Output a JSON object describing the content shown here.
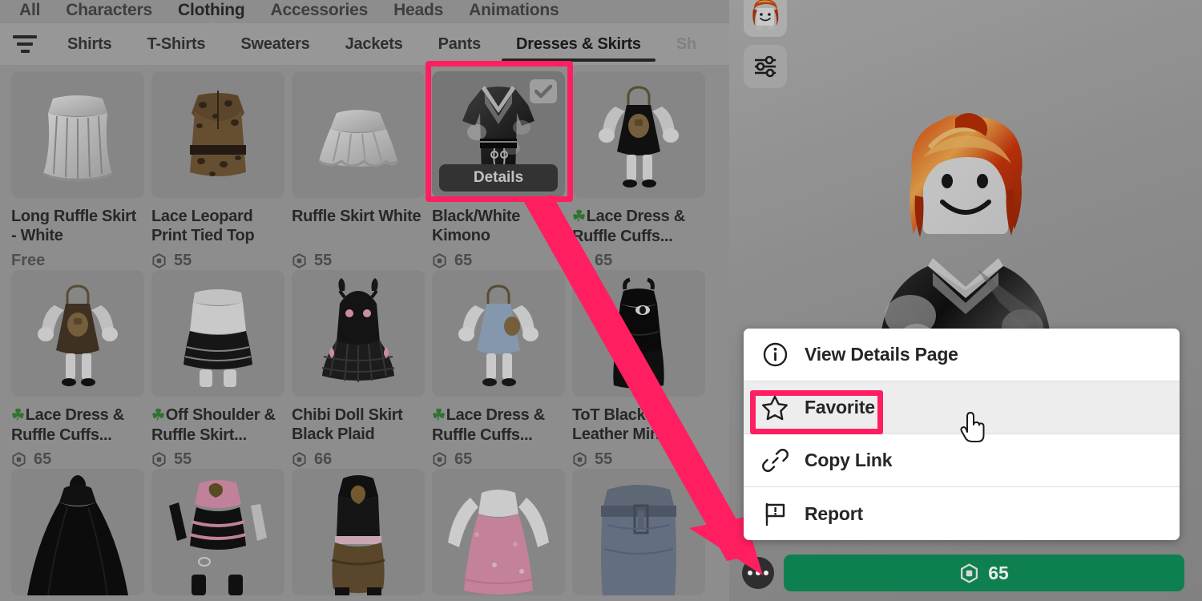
{
  "category_nav": {
    "items": [
      {
        "label": "All",
        "active": false
      },
      {
        "label": "Characters",
        "active": false
      },
      {
        "label": "Clothing",
        "active": true
      },
      {
        "label": "Accessories",
        "active": false
      },
      {
        "label": "Heads",
        "active": false
      },
      {
        "label": "Animations",
        "active": false
      }
    ]
  },
  "tab_strip": {
    "filter_icon": "filter-sort-icon",
    "tabs": [
      {
        "label": "Shirts",
        "active": false
      },
      {
        "label": "T-Shirts",
        "active": false
      },
      {
        "label": "Sweaters",
        "active": false
      },
      {
        "label": "Jackets",
        "active": false
      },
      {
        "label": "Pants",
        "active": false
      },
      {
        "label": "Dresses & Skirts",
        "active": true
      },
      {
        "label": "Sh",
        "active": false,
        "clipped": true
      }
    ]
  },
  "grid": {
    "details_label": "Details",
    "items": [
      {
        "title": "Long Ruffle Skirt - White",
        "price": "Free",
        "free": true,
        "clover": false,
        "selected": false,
        "thumb": "long-ruffle-skirt-white"
      },
      {
        "title": "Lace Leopard Print Tied Top",
        "price": "55",
        "free": false,
        "clover": false,
        "selected": false,
        "thumb": "lace-leopard-print-tied-top"
      },
      {
        "title": "Ruffle Skirt White",
        "price": "55",
        "free": false,
        "clover": false,
        "selected": false,
        "thumb": "ruffle-skirt-white"
      },
      {
        "title": "Black/White Kimono",
        "price": "65",
        "free": false,
        "clover": false,
        "selected": true,
        "thumb": "black-white-kimono"
      },
      {
        "title": "Lace Dress & Ruffle Cuffs...",
        "price": "65",
        "free": false,
        "clover": true,
        "selected": false,
        "thumb": "lace-dress-ruffle-cuffs-black"
      },
      {
        "title": "Lace Dress & Ruffle Cuffs...",
        "price": "65",
        "free": false,
        "clover": true,
        "selected": false,
        "thumb": "lace-dress-ruffle-cuffs-brown"
      },
      {
        "title": "Off Shoulder & Ruffle Skirt...",
        "price": "55",
        "free": false,
        "clover": true,
        "selected": false,
        "thumb": "off-shoulder-ruffle-skirt"
      },
      {
        "title": "Chibi Doll Skirt Black Plaid",
        "price": "66",
        "free": false,
        "clover": false,
        "selected": false,
        "thumb": "chibi-doll-skirt-black-plaid"
      },
      {
        "title": "Lace Dress & Ruffle Cuffs...",
        "price": "65",
        "free": false,
        "clover": true,
        "selected": false,
        "thumb": "lace-dress-ruffle-cuffs-blue"
      },
      {
        "title": "ToT Black Leather Mini",
        "price": "55",
        "free": false,
        "clover": false,
        "selected": false,
        "thumb": "tot-black-leather-mini"
      },
      {
        "title": "",
        "price": "",
        "free": false,
        "clover": false,
        "selected": false,
        "thumb": "black-gown-partial"
      },
      {
        "title": "",
        "price": "",
        "free": false,
        "clover": false,
        "selected": false,
        "thumb": "pink-black-outfit-partial"
      },
      {
        "title": "",
        "price": "",
        "free": false,
        "clover": false,
        "selected": false,
        "thumb": "brown-corset-skirt-partial"
      },
      {
        "title": "",
        "price": "",
        "free": false,
        "clover": false,
        "selected": false,
        "thumb": "pink-white-dress-partial"
      },
      {
        "title": "",
        "price": "",
        "free": false,
        "clover": false,
        "selected": false,
        "thumb": "denim-skirt-partial"
      }
    ]
  },
  "preview": {
    "avatar_button_name": "avatar-thumbnail",
    "settings_button_name": "avatar-settings-sliders",
    "more_button_label": "More options",
    "buy_price": "65"
  },
  "context_menu": {
    "items": [
      {
        "label": "View Details Page",
        "icon": "info-circle-icon",
        "hovered": false
      },
      {
        "label": "Favorite",
        "icon": "star-outline-icon",
        "hovered": true
      },
      {
        "label": "Copy Link",
        "icon": "link-chain-icon",
        "hovered": false
      },
      {
        "label": "Report",
        "icon": "flag-icon",
        "hovered": false
      }
    ]
  },
  "annotations": {
    "accent_color": "#ff1f61",
    "arrow_from": "selected-item-card",
    "arrow_to": "more-options-button",
    "highlight_selected_card": true,
    "highlight_favorite_item": true
  },
  "colors": {
    "accent": "#ff1f61",
    "buy_green": "#0e8050",
    "panel_bg": "#a8a8a8",
    "tab_bg": "#b4b4b4",
    "menu_bg": "#ffffff",
    "clover_green": "#3a8a3a"
  }
}
